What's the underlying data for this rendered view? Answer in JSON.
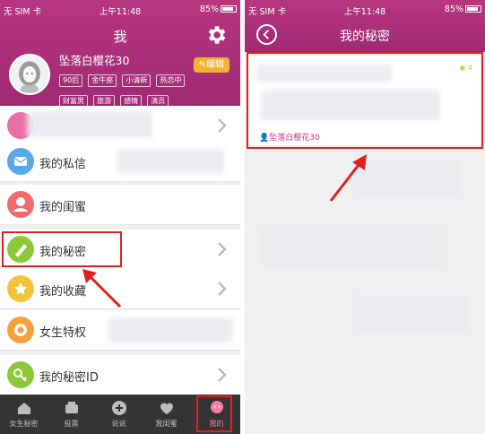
{
  "status_bar": {
    "carrier": "无 SIM 卡",
    "time": "上午11:48",
    "battery": "85%"
  },
  "left": {
    "title": "我",
    "username": "坠落白樱花30",
    "edit_label": "编辑",
    "tags": [
      "90后",
      "金牛座",
      "小清新",
      "热恋中",
      "财富男",
      "旅游",
      "感情",
      "演员"
    ],
    "menu": [
      {
        "label": "我的私信",
        "icon": "message-icon",
        "color": "#5aa8e8"
      },
      {
        "label": "我的闺蜜",
        "icon": "bestie-icon",
        "color": "#ef6a6a"
      },
      {
        "label": "我的秘密",
        "icon": "secret-icon",
        "color": "#8dc83b"
      },
      {
        "label": "我的收藏",
        "icon": "favorite-icon",
        "color": "#f3c43a"
      },
      {
        "label": "女生特权",
        "icon": "privilege-icon",
        "color": "#f5a03c"
      },
      {
        "label": "我的秘密ID",
        "icon": "key-icon",
        "color": "#8dc83b"
      }
    ],
    "tabs": [
      {
        "label": "女生秘密",
        "icon": "home-icon"
      },
      {
        "label": "投票",
        "icon": "vote-icon"
      },
      {
        "label": "说说",
        "icon": "plus-icon"
      },
      {
        "label": "我闺蜜",
        "icon": "bestie-tab-icon"
      },
      {
        "label": "我的",
        "icon": "me-icon"
      }
    ]
  },
  "right": {
    "title": "我的秘密",
    "post": {
      "author": "坠落白樱花30",
      "views": "4"
    }
  },
  "colors": {
    "header": "#a72d78",
    "accent_pink": "#c83a86",
    "edit_yellow": "#f2b233",
    "tabbar": "#343434",
    "highlight_red": "#e02020"
  }
}
